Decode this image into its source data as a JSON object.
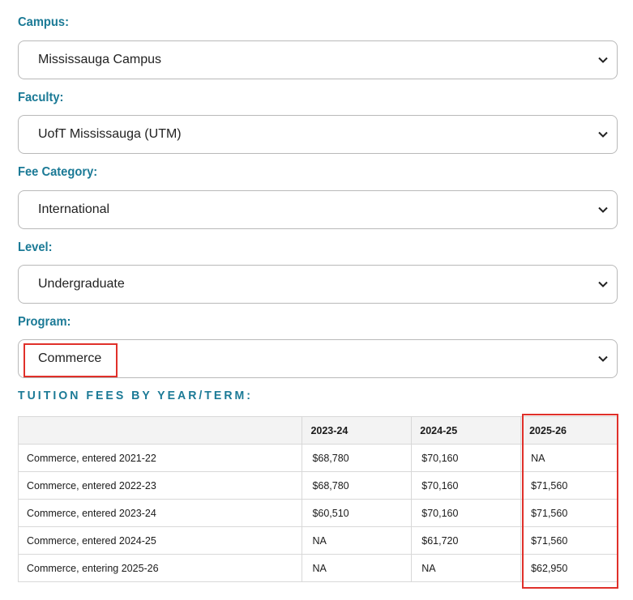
{
  "form": {
    "campus": {
      "label": "Campus:",
      "value": "Mississauga Campus"
    },
    "faculty": {
      "label": "Faculty:",
      "value": "UofT Mississauga (UTM)"
    },
    "fee_category": {
      "label": "Fee Category:",
      "value": "International"
    },
    "level": {
      "label": "Level:",
      "value": "Undergraduate"
    },
    "program": {
      "label": "Program:",
      "value": "Commerce"
    }
  },
  "tuition": {
    "heading": "TUITION FEES BY YEAR/TERM:",
    "columns": [
      "",
      "2023-24",
      "2024-25",
      "2025-26"
    ],
    "rows": [
      {
        "label": "Commerce, entered 2021-22",
        "values": [
          "$68,780",
          "$70,160",
          "NA"
        ]
      },
      {
        "label": "Commerce, entered 2022-23",
        "values": [
          "$68,780",
          "$70,160",
          "$71,560"
        ]
      },
      {
        "label": "Commerce, entered 2023-24",
        "values": [
          "$60,510",
          "$70,160",
          "$71,560"
        ]
      },
      {
        "label": "Commerce, entered 2024-25",
        "values": [
          "NA",
          "$61,720",
          "$71,560"
        ]
      },
      {
        "label": "Commerce, entering 2025-26",
        "values": [
          "NA",
          "NA",
          "$62,950"
        ]
      }
    ]
  },
  "colors": {
    "label": "#1b7a96",
    "highlight": "#e0302a",
    "border": "#b9b9b9",
    "table_header_bg": "#f3f3f3"
  },
  "icons": {
    "select_arrow": "chevron-down-icon"
  }
}
